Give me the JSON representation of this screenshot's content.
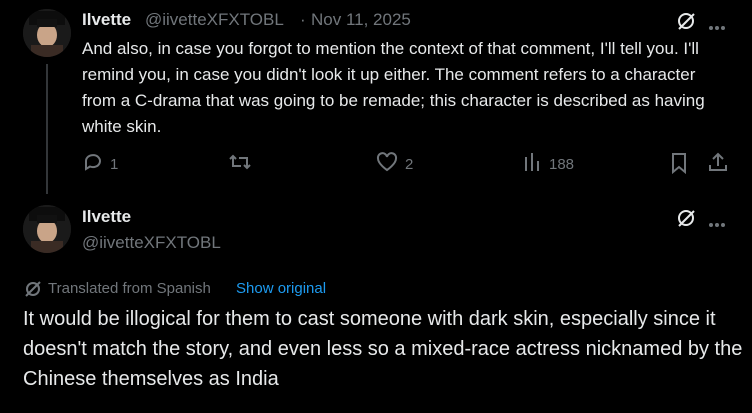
{
  "tweets": [
    {
      "display_name": "Ilvette",
      "handle": "@iivetteXFXTOBL",
      "separator": "·",
      "date": "Nov 11, 2025",
      "text": "And also, in case you forgot to mention the context of that comment, I'll tell you. I'll remind you, in case you didn't look it up either. The comment refers to a character from a C-drama that was going to be remade; this character is described as having white skin.",
      "actions": {
        "replies": "1",
        "retweets": "",
        "likes": "2",
        "views": "188"
      }
    },
    {
      "display_name": "Ilvette",
      "handle": "@iivetteXFXTOBL",
      "translated_label": "Translated from Spanish",
      "show_original": "Show original",
      "text": "It would be illogical for them to cast someone with dark skin, especially since it doesn't match the story, and even less so a mixed-race actress nicknamed by the Chinese themselves as India"
    }
  ],
  "icons": {
    "grok": "grok-icon",
    "more": "more-icon",
    "reply": "reply-icon",
    "retweet": "retweet-icon",
    "like": "heart-icon",
    "views": "views-icon",
    "bookmark": "bookmark-icon",
    "share": "share-icon",
    "translate": "translate-icon"
  },
  "colors": {
    "background": "#000000",
    "text": "#e7e9ea",
    "muted": "#71767b",
    "link": "#1d9bf0"
  }
}
